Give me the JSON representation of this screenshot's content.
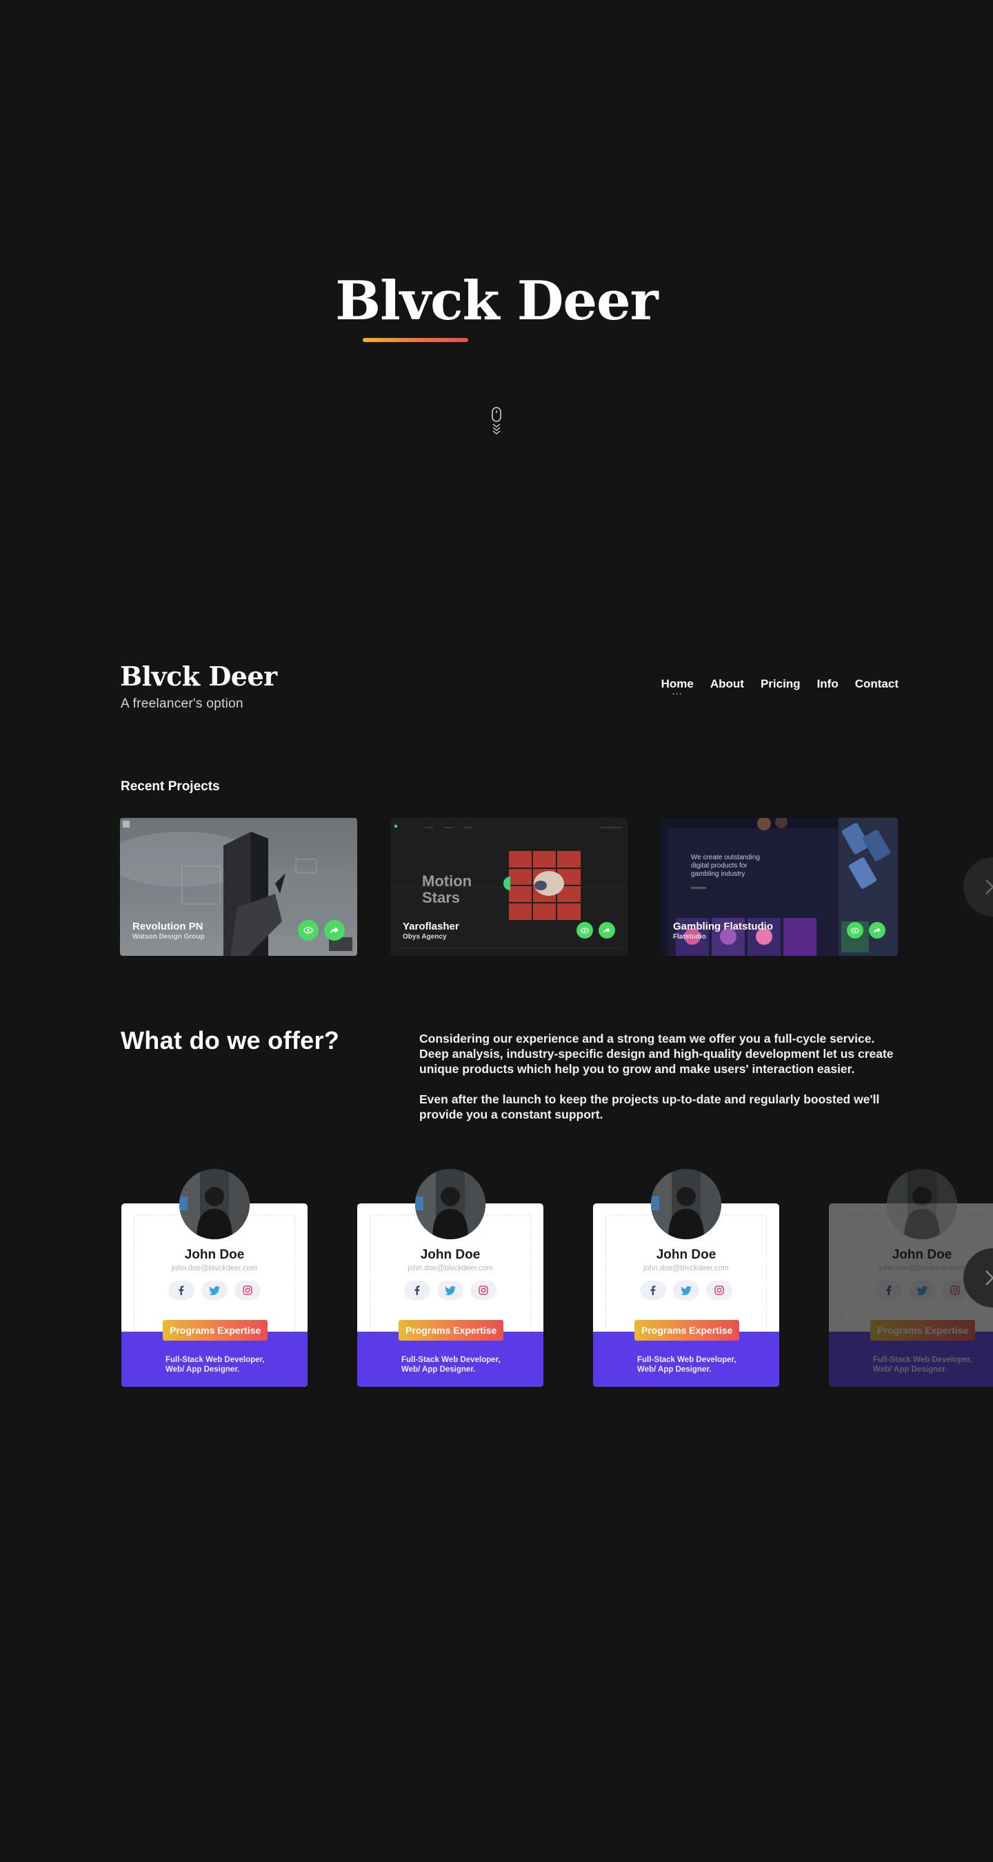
{
  "hero": {
    "title": "Blvck Deer"
  },
  "header": {
    "brand": "Blvck Deer",
    "tagline": "A freelancer's option",
    "nav": [
      {
        "label": "Home",
        "active": true
      },
      {
        "label": "About"
      },
      {
        "label": "Pricing"
      },
      {
        "label": "Info"
      },
      {
        "label": "Contact"
      }
    ]
  },
  "projects": {
    "title": "Recent Projects",
    "items": [
      {
        "name": "Revolution PN",
        "client": "Watson Design Group"
      },
      {
        "name": "Yaroflasher",
        "client": "Obys Agency",
        "thumb_text_1": "Motion",
        "thumb_text_2": "Stars"
      },
      {
        "name": "Gambling Flatstudio",
        "client": "Flatstudio",
        "thumb_text_1": "We create outstanding",
        "thumb_text_2": "digital products for",
        "thumb_text_3": "gambling industry"
      }
    ]
  },
  "offer": {
    "title": "What do we offer?",
    "paragraph1": "Considering our experience and a strong team we offer you a full-cycle service. Deep analysis, industry-specific design and high-quality development let us create unique products which help you to grow and make users' interaction easier.",
    "paragraph2": "Even after the launch to keep the projects up-to-date and regularly boosted we'll provide you a constant support."
  },
  "team": [
    {
      "name": "John Doe",
      "email": "john.doe@blvckdeer.com",
      "badge": "Programs Expertise",
      "role_line1": "Full-Stack Web Developer,",
      "role_line2": "Web/ App Designer."
    },
    {
      "name": "John Doe",
      "email": "john.doe@blvckdeer.com",
      "badge": "Programs Expertise",
      "role_line1": "Full-Stack Web Developer,",
      "role_line2": "Web/ App Designer."
    },
    {
      "name": "John Doe",
      "email": "john.doe@blvckdeer.com",
      "badge": "Programs Expertise",
      "role_line1": "Full-Stack Web Developer,",
      "role_line2": "Web/ App Designer."
    },
    {
      "name": "John Doe",
      "email": "john.doe@blvckdeer.com",
      "badge": "Programs Expertise",
      "role_line1": "Full-Stack Web Developer,",
      "role_line2": "Web/ App Designer."
    }
  ],
  "colors": {
    "background": "#141414",
    "accent_green": "#4cd964",
    "accent_purple": "#5b3be8",
    "gradient_start": "#f0b429",
    "gradient_end": "#e4504e"
  },
  "icons": {
    "scroll": "mouse-scroll-icon",
    "view": "eye-icon",
    "share": "share-icon",
    "next": "chevron-right-icon",
    "facebook": "facebook-icon",
    "twitter": "twitter-icon",
    "instagram": "instagram-icon"
  }
}
